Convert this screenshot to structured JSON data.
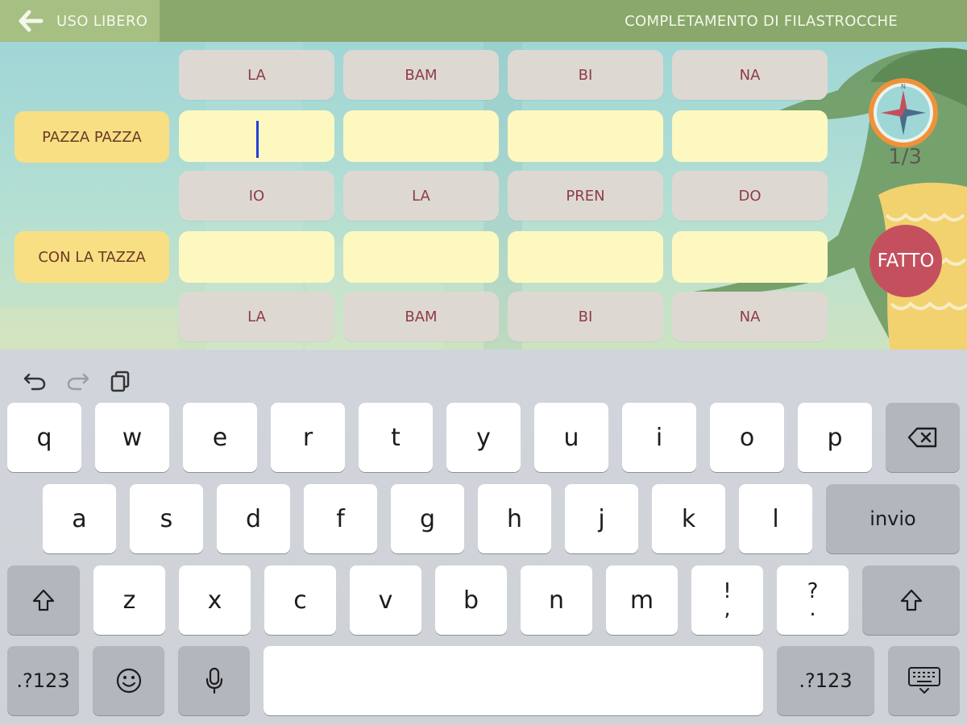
{
  "header": {
    "back_label": "USO LIBERO",
    "title": "COMPLETAMENTO DI FILASTROCCHE"
  },
  "exercise": {
    "syllable_rows": [
      [
        "LA",
        "BAM",
        "BI",
        "NA"
      ],
      [
        "IO",
        "LA",
        "PREN",
        "DO"
      ],
      [
        "LA",
        "BAM",
        "BI",
        "NA"
      ]
    ],
    "line_labels": [
      "PAZZA PAZZA",
      "CON LA TAZZA"
    ],
    "input_values": [
      [
        "",
        "",
        "",
        ""
      ],
      [
        "",
        "",
        "",
        ""
      ]
    ],
    "progress": "1/3",
    "done_label": "FATTO",
    "compass_letter": "N"
  },
  "keyboard": {
    "row1": [
      "q",
      "w",
      "e",
      "r",
      "t",
      "y",
      "u",
      "i",
      "o",
      "p"
    ],
    "row2": [
      "a",
      "s",
      "d",
      "f",
      "g",
      "h",
      "j",
      "k",
      "l"
    ],
    "row3": [
      "z",
      "x",
      "c",
      "v",
      "b",
      "n",
      "m"
    ],
    "punct1_top": "!",
    "punct1_bottom": ",",
    "punct2_top": "?",
    "punct2_bottom": ".",
    "return_label": "invio",
    "numbers_label": ".?123",
    "icons": {
      "undo": "undo-icon",
      "redo": "redo-icon",
      "paste": "paste-icon",
      "backspace": "backspace-icon",
      "shift": "shift-icon",
      "emoji": "emoji-icon",
      "mic": "microphone-icon",
      "hide": "keyboard-hide-icon"
    }
  },
  "colors": {
    "header_bar": "#8aa86b",
    "syllable_text": "#8e3b48",
    "input_fill": "#fdf8c0",
    "label_fill": "#f8df83",
    "done_button": "#c4505e",
    "caret": "#2340d6"
  }
}
